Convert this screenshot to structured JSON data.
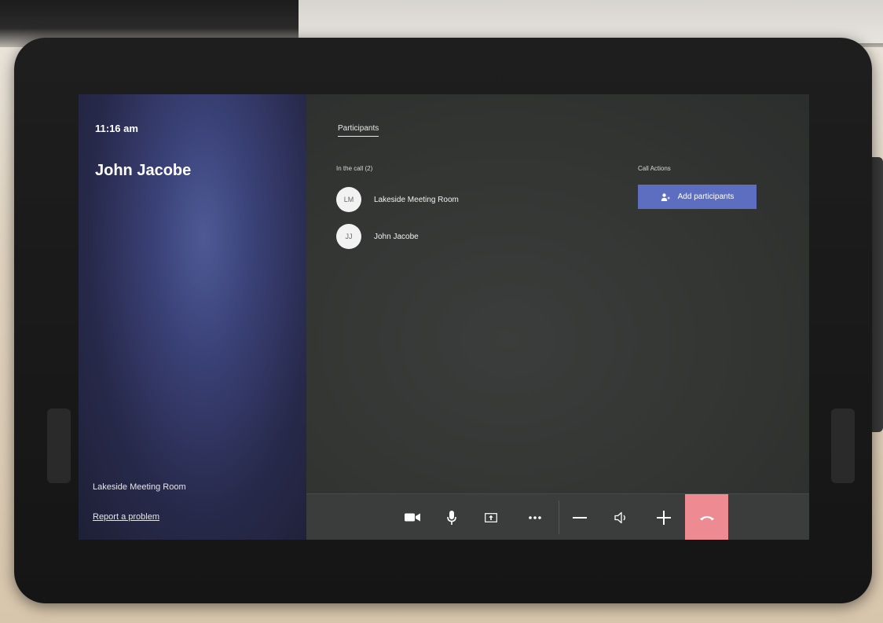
{
  "status": {
    "time": "11:16 am"
  },
  "caller": {
    "name": "John Jacobe"
  },
  "device": {
    "room_name": "Lakeside Meeting Room",
    "report_link": "Report a problem"
  },
  "tabs": {
    "participants_label": "Participants"
  },
  "participants": {
    "section_label": "In the call (2)",
    "items": [
      {
        "initials": "LM",
        "name": "Lakeside Meeting Room"
      },
      {
        "initials": "JJ",
        "name": "John Jacobe"
      }
    ]
  },
  "call_actions": {
    "section_label": "Call Actions",
    "add_button_label": "Add participants"
  },
  "controls": {
    "icons": [
      "video-icon",
      "microphone-icon",
      "share-screen-icon",
      "more-options-icon",
      "volume-down-icon",
      "speaker-icon",
      "volume-up-icon",
      "hang-up-icon"
    ]
  },
  "colors": {
    "accent": "#5d6ec0",
    "hangup": "#ee8a92",
    "panel_left": "#3a4177",
    "panel_main": "#333533"
  }
}
